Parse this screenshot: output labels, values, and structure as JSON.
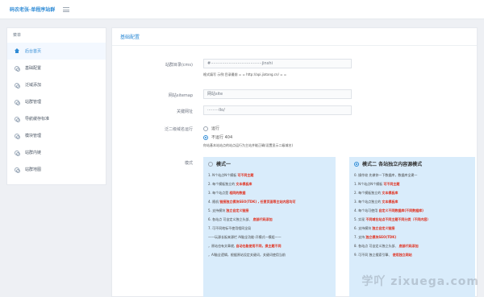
{
  "app": {
    "brand": "码农老张·单程序站群",
    "menu_icon": "hamburger-icon"
  },
  "sidebar": {
    "header": "菜单",
    "items": [
      {
        "label": "后台首页",
        "icon": "home-icon",
        "active": true
      },
      {
        "label": "基础配置",
        "icon": "gear-icon"
      },
      {
        "label": "泛域添加",
        "icon": "gear-icon"
      },
      {
        "label": "站群管理",
        "icon": "gear-icon"
      },
      {
        "label": "导航缓存标准",
        "icon": "gear-icon"
      },
      {
        "label": "模块管理",
        "icon": "gear-icon"
      },
      {
        "label": "站群内链",
        "icon": "gear-icon"
      },
      {
        "label": "站群地图",
        "icon": "gear-icon"
      }
    ]
  },
  "main": {
    "title": "基础配置",
    "fields": [
      {
        "label": "站群目录(cms)",
        "value": "#········································jinshi",
        "hint": "格式填写 示例:目录最前 = = http://api.jiatang.cn/ = ="
      },
      {
        "label": "网站sitemap",
        "value": "网站site"
      },
      {
        "label": "关键网址",
        "value": "·········Ilo/"
      }
    ],
    "second_domain": {
      "label": "泛二级域名运行",
      "options": [
        {
          "label": "运行",
          "checked": false
        },
        {
          "label": "不运行 404",
          "checked": true
        }
      ],
      "hint": "你站基本站站点的站点运行为主站并能正确(设置显示二级域名)"
    },
    "mode_label": "模式",
    "mode1": {
      "title": "模式一",
      "checked": false,
      "lines": [
        [
          {
            "t": "1. N个站点N个模板 "
          },
          {
            "t": "可不同主题",
            "red": true
          }
        ],
        [
          {
            "t": "2. 每个模板独立的 "
          },
          {
            "t": "文本模板库",
            "red": true
          }
        ],
        [
          {
            "t": "3. 每个站点是 "
          },
          {
            "t": "相同的数据",
            "red": true
          }
        ],
        [
          {
            "t": "4. 随机 "
          },
          {
            "t": "链接独立模块SEO(TDK) , 任意页面等主站内容均可",
            "red": true
          }
        ],
        [
          {
            "t": "5. 支持模块 "
          },
          {
            "t": "独立自定义链接",
            "red": true
          }
        ],
        [
          {
            "t": "6. 各站点 可自定义独立头部、 "
          },
          {
            "t": "底部代码添加",
            "red": true
          }
        ],
        [
          {
            "t": "7. 可不同地标不使用相同全局"
          }
        ],
        [
          {
            "t": "——玩源长板来源栏 AI脑全功能-开模式一模组——"
          }
        ],
        [
          {
            "t": "，原站也有文章就, "
          },
          {
            "t": "自动也能使用不同，换主题不同",
            "red": true
          }
        ],
        [
          {
            "t": "，AI脑全逻辑，根据原站设定关键词，关键词使用当前"
          }
        ]
      ]
    },
    "mode2": {
      "title": "模式二 各站独立内容源模式",
      "checked": true,
      "lines": [
        [
          {
            "t": "0. 操作较 先做你一下数据库，数据库全建一"
          }
        ],
        [
          {
            "t": "1. N个站点N个模板 "
          },
          {
            "t": "可不同主题",
            "red": true
          }
        ],
        [
          {
            "t": "2. 每个模板独立的 "
          },
          {
            "t": "文本模板库",
            "red": true
          }
        ],
        [
          {
            "t": "3. 每个站点独立的 "
          },
          {
            "t": "文本模板库",
            "red": true
          }
        ],
        [
          {
            "t": "4. 每个站可使用 "
          },
          {
            "t": "自定义不同数据库(不同数据库)",
            "red": true
          }
        ],
        [
          {
            "t": "5. 实现 "
          },
          {
            "t": "不同域名站点不同主题不同分类（不同内容）",
            "red": true
          }
        ],
        [
          {
            "t": "6. 支持模块 "
          },
          {
            "t": "独立自定义链接",
            "red": true
          }
        ],
        [
          {
            "t": "7. 支持 "
          },
          {
            "t": "独立模块SEO(TDK)",
            "red": true
          }
        ],
        [
          {
            "t": "8. 各站点 可自定义独立头部、 "
          },
          {
            "t": "底部代码添加",
            "red": true
          }
        ],
        [
          {
            "t": "9. 可不同 "
          },
          {
            "t": "独立搜索引擎、 "
          },
          {
            "t": "使用独立网站",
            "red": true
          }
        ]
      ]
    }
  },
  "watermark": "学吖 zixuega.com"
}
